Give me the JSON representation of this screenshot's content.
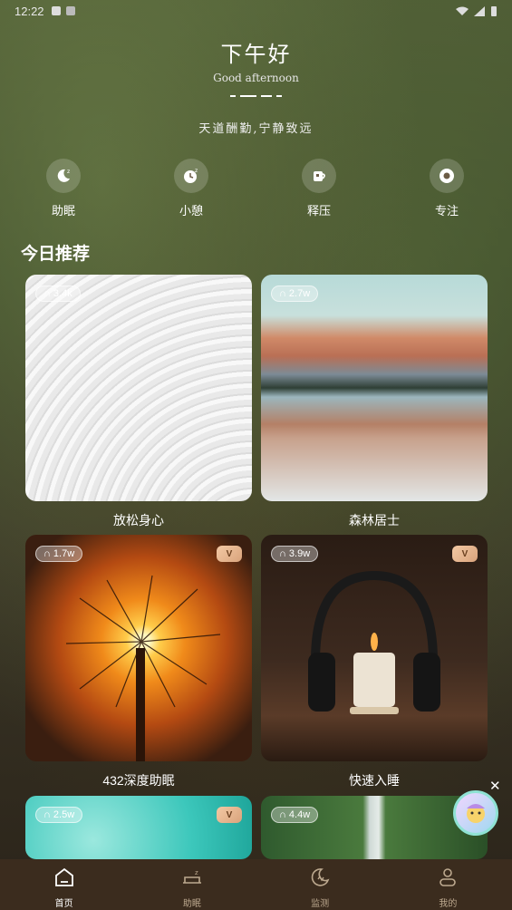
{
  "status_bar": {
    "time": "12:22"
  },
  "header": {
    "greeting_cn": "下午好",
    "greeting_en": "Good afternoon",
    "motto": "天道酬勤,宁静致远"
  },
  "quick_actions": [
    {
      "label": "助眠",
      "icon": "sleep-moon-icon"
    },
    {
      "label": "小憩",
      "icon": "nap-clock-icon"
    },
    {
      "label": "释压",
      "icon": "coffee-cup-icon"
    },
    {
      "label": "专注",
      "icon": "focus-target-icon"
    }
  ],
  "section_title": "今日推荐",
  "cards": [
    {
      "title": "放松身心",
      "plays": "3.4k",
      "vip": false,
      "image": "white-texture"
    },
    {
      "title": "森林居士",
      "plays": "2.7w",
      "vip": false,
      "image": "mountain-lake"
    },
    {
      "title": "432深度助眠",
      "plays": "1.7w",
      "vip": true,
      "image": "dandelion-sunset"
    },
    {
      "title": "快速入睡",
      "plays": "3.9w",
      "vip": true,
      "image": "headphones-candle"
    },
    {
      "title": "",
      "plays": "2.5w",
      "vip": true,
      "image": "teal-droplets"
    },
    {
      "title": "",
      "plays": "4.4w",
      "vip": true,
      "image": "forest-waterfall"
    }
  ],
  "vip_badge_text": "V",
  "tabbar": [
    {
      "label": "首页",
      "icon": "home-icon",
      "active": true
    },
    {
      "label": "助眠",
      "icon": "sleep-bed-icon",
      "active": false
    },
    {
      "label": "监测",
      "icon": "monitor-moon-icon",
      "active": false
    },
    {
      "label": "我的",
      "icon": "profile-icon",
      "active": false
    }
  ],
  "floating": {
    "close_label": "✕"
  },
  "colors": {
    "tabbar_bg": "#3b2c1e",
    "tab_inactive": "#bda98f",
    "vip_gold": "#d9a37c"
  }
}
